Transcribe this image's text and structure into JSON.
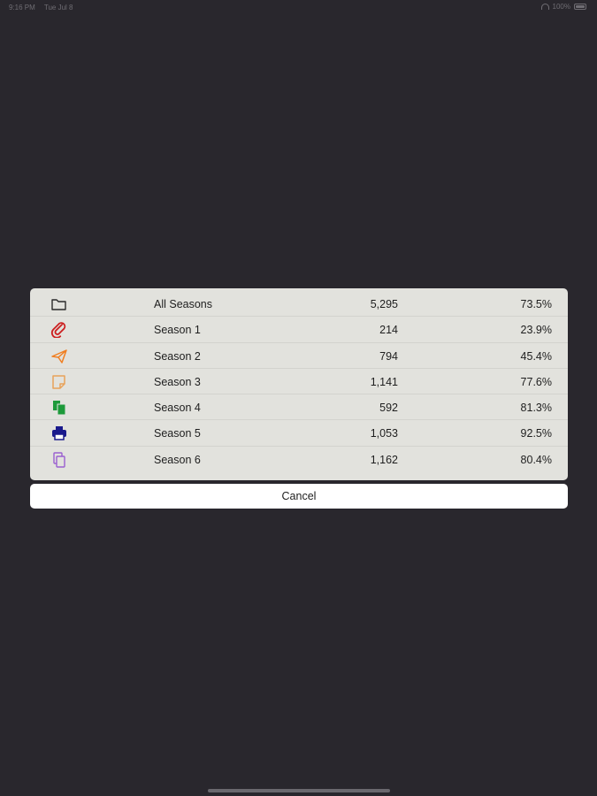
{
  "status_bar": {
    "time": "9:16 PM",
    "date": "Tue Jul 8",
    "battery": "100%"
  },
  "rows": [
    {
      "label": "All Seasons",
      "count": "5,295",
      "percent": "73.5%",
      "icon": "folder-icon",
      "color": "#2b2b2b"
    },
    {
      "label": "Season 1",
      "count": "214",
      "percent": "23.9%",
      "icon": "paperclip-icon",
      "color": "#cc1f1f"
    },
    {
      "label": "Season 2",
      "count": "794",
      "percent": "45.4%",
      "icon": "paper-plane-icon",
      "color": "#f07f22"
    },
    {
      "label": "Season 3",
      "count": "1,141",
      "percent": "77.6%",
      "icon": "sticky-note-icon",
      "color": "#e8a25a"
    },
    {
      "label": "Season 4",
      "count": "592",
      "percent": "81.3%",
      "icon": "copy-filled-icon",
      "color": "#1d9a3a"
    },
    {
      "label": "Season 5",
      "count": "1,053",
      "percent": "92.5%",
      "icon": "printer-icon",
      "color": "#1a1a8c"
    },
    {
      "label": "Season 6",
      "count": "1,162",
      "percent": "80.4%",
      "icon": "copy-outline-icon",
      "color": "#9a5fd0"
    }
  ],
  "cancel_label": "Cancel"
}
